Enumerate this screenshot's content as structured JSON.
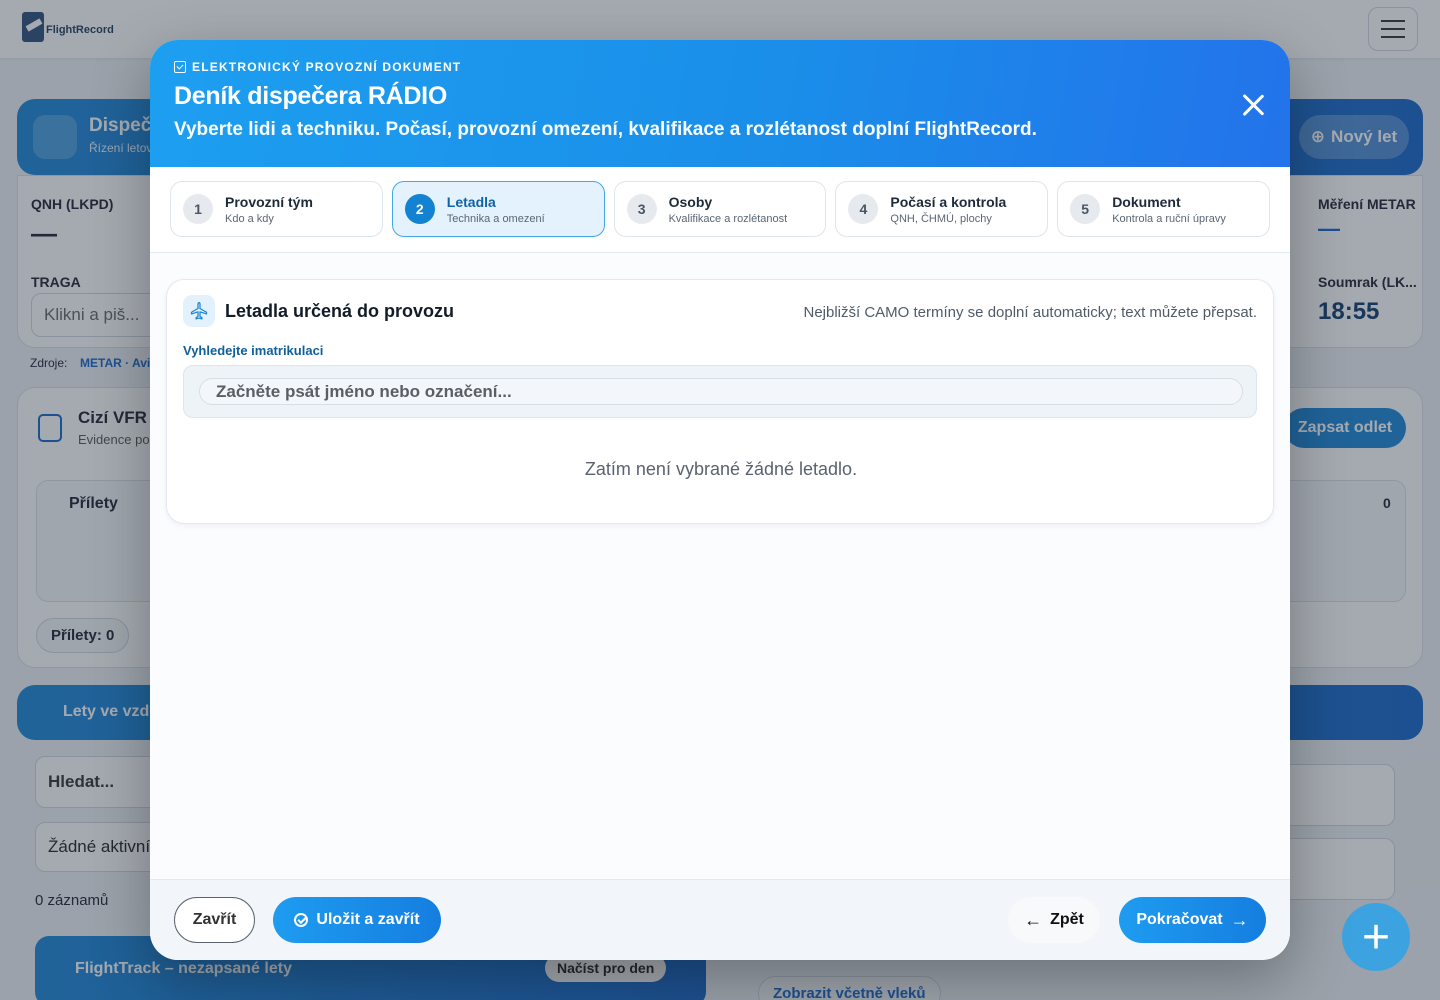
{
  "background": {
    "logo_text": "FlightRecord",
    "dispatch_title": "Dispeč",
    "dispatch_sub": "Řízení letov",
    "new_flight_label": "Nový let",
    "qnh_label": "QNH (LKPD)",
    "qnh_value": "—",
    "metar_label": "Měření METAR",
    "metar_value": "—",
    "traga_label": "TRAGA",
    "traga_placeholder": "Klikni a piš...",
    "dusk_label": "Soumrak (LK...",
    "dusk_value": "18:55",
    "source_label": "Zdroje:",
    "source_value": "METAR · Avia",
    "foreign_vfr_title": "Cizí VFR",
    "foreign_vfr_sub": "Evidence po",
    "record_departure_label": "Zapsat odlet",
    "arrivals_title": "Přílety",
    "arrivals_count": "0",
    "arrivals_pill": "Přílety: 0",
    "in_air_title": "Lety ve vzd",
    "search_placeholder": "Hledat...",
    "no_active": "Žádné aktivní",
    "records_count": "0 záznamů",
    "flighttrack_title": "FlightTrack – nezapsané lety",
    "load_day_label": "Načíst pro den",
    "show_tows_label": "Zobrazit včetně vleků"
  },
  "modal": {
    "eyebrow": "ELEKTRONICKÝ PROVOZNÍ DOKUMENT",
    "title": "Deník dispečera RÁDIO",
    "subtitle": "Vyberte lidi a techniku. Počasí, provozní omezení, kvalifikace a rozlétanost doplní FlightRecord.",
    "steps": [
      {
        "num": "1",
        "title": "Provozní tým",
        "sub": "Kdo a kdy"
      },
      {
        "num": "2",
        "title": "Letadla",
        "sub": "Technika a omezení"
      },
      {
        "num": "3",
        "title": "Osoby",
        "sub": "Kvalifikace a rozlétanost"
      },
      {
        "num": "4",
        "title": "Počasí a kontrola",
        "sub": "QNH, ČHMÚ, plochy"
      },
      {
        "num": "5",
        "title": "Dokument",
        "sub": "Kontrola a ruční úpravy"
      }
    ],
    "active_step": 2,
    "card": {
      "title": "Letadla určená do provozu",
      "hint": "Nejbližší CAMO termíny se doplní automaticky; text můžete přepsat.",
      "field_label": "Vyhledejte imatrikulaci",
      "search_placeholder": "Začněte psát jméno nebo označení...",
      "empty_message": "Zatím není vybrané žádné letadlo."
    },
    "footer": {
      "close_label": "Zavřít",
      "save_label": "Uložit a zavřít",
      "back_label": "Zpět",
      "next_label": "Pokračovat"
    }
  },
  "colors": {
    "accent": "#1a8ee9",
    "header_gradient_end": "#2373ea",
    "active_step_bg": "#e3f2fc"
  }
}
